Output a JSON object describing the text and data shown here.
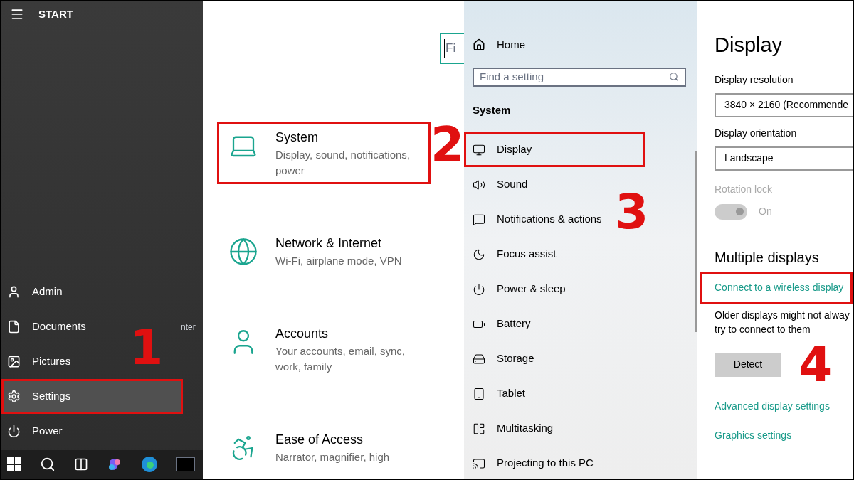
{
  "start_menu": {
    "title": "START",
    "items": [
      {
        "label": "Admin",
        "highlighted": false
      },
      {
        "label": "Documents",
        "highlighted": false
      },
      {
        "label": "Pictures",
        "highlighted": false
      },
      {
        "label": "Settings",
        "highlighted": true
      },
      {
        "label": "Power",
        "highlighted": false
      }
    ],
    "behind_text": "nter",
    "step": "1"
  },
  "settings_home": {
    "search": {
      "placeholder": "Fi"
    },
    "categories": [
      {
        "title": "System",
        "description": "Display, sound, notifications, power",
        "highlighted": true
      },
      {
        "title": "Network & Internet",
        "description": "Wi-Fi, airplane mode, VPN",
        "highlighted": false
      },
      {
        "title": "Accounts",
        "description": "Your accounts, email, sync, work, family",
        "highlighted": false
      },
      {
        "title": "Ease of Access",
        "description": "Narrator, magnifier, high",
        "highlighted": false
      }
    ],
    "step": "2"
  },
  "system_nav": {
    "home": "Home",
    "search": {
      "placeholder": "Find a setting"
    },
    "section": "System",
    "items": [
      {
        "label": "Display",
        "highlighted": true
      },
      {
        "label": "Sound",
        "highlighted": false
      },
      {
        "label": "Notifications & actions",
        "highlighted": false
      },
      {
        "label": "Focus assist",
        "highlighted": false
      },
      {
        "label": "Power & sleep",
        "highlighted": false
      },
      {
        "label": "Battery",
        "highlighted": false
      },
      {
        "label": "Storage",
        "highlighted": false
      },
      {
        "label": "Tablet",
        "highlighted": false
      },
      {
        "label": "Multitasking",
        "highlighted": false
      },
      {
        "label": "Projecting to this PC",
        "highlighted": false
      }
    ],
    "step": "3"
  },
  "display_page": {
    "title": "Display",
    "resolution_label": "Display resolution",
    "resolution_value": "3840 × 2160 (Recommende",
    "orientation_label": "Display orientation",
    "orientation_value": "Landscape",
    "rotation_lock": {
      "label": "Rotation lock",
      "on": true,
      "disabled": true,
      "state_text": "On"
    },
    "multiple_heading": "Multiple displays",
    "connect_link": {
      "label": "Connect to a wireless display",
      "highlighted": true
    },
    "older_text": [
      "Older displays might not alway",
      "try to connect to them"
    ],
    "detect_button": "Detect",
    "links": [
      "Advanced display settings",
      "Graphics settings"
    ],
    "step": "4"
  }
}
